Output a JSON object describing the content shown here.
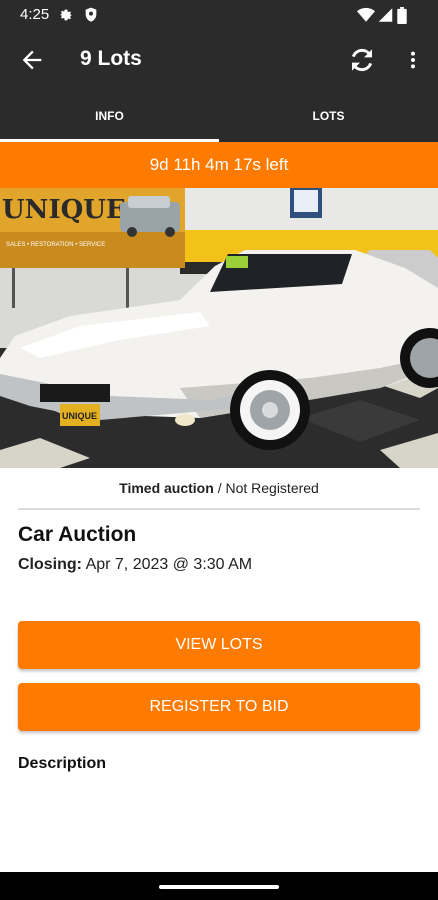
{
  "status_bar": {
    "time": "4:25",
    "icons": [
      "settings-gear-icon",
      "shield-icon",
      "wifi-icon",
      "signal-icon",
      "battery-icon"
    ]
  },
  "app_bar": {
    "title": "9 Lots",
    "icons": [
      "back-arrow-icon",
      "refresh-icon",
      "more-vert-icon"
    ]
  },
  "tabs": [
    {
      "label": "INFO",
      "selected": true
    },
    {
      "label": "LOTS",
      "selected": false
    }
  ],
  "timer": {
    "text": "9d 11h 4m 17s left"
  },
  "hero_image": {
    "sign_text": "UNIQUE",
    "sign_subtext": "SALES • RESTORATION • SERVICE",
    "plate_text": "UNIQUE"
  },
  "registration": {
    "type": "Timed auction",
    "status": "/ Not Registered"
  },
  "auction": {
    "title": "Car Auction",
    "closing_label": "Closing:",
    "closing_value": "Apr 7, 2023 @ 3:30 AM"
  },
  "buttons": {
    "view_lots": "VIEW LOTS",
    "register": "REGISTER TO BID"
  },
  "description_heading": "Description",
  "colors": {
    "accent": "#ff7a00",
    "bar": "#2b2b2b",
    "content_bg": "#ffffff"
  }
}
